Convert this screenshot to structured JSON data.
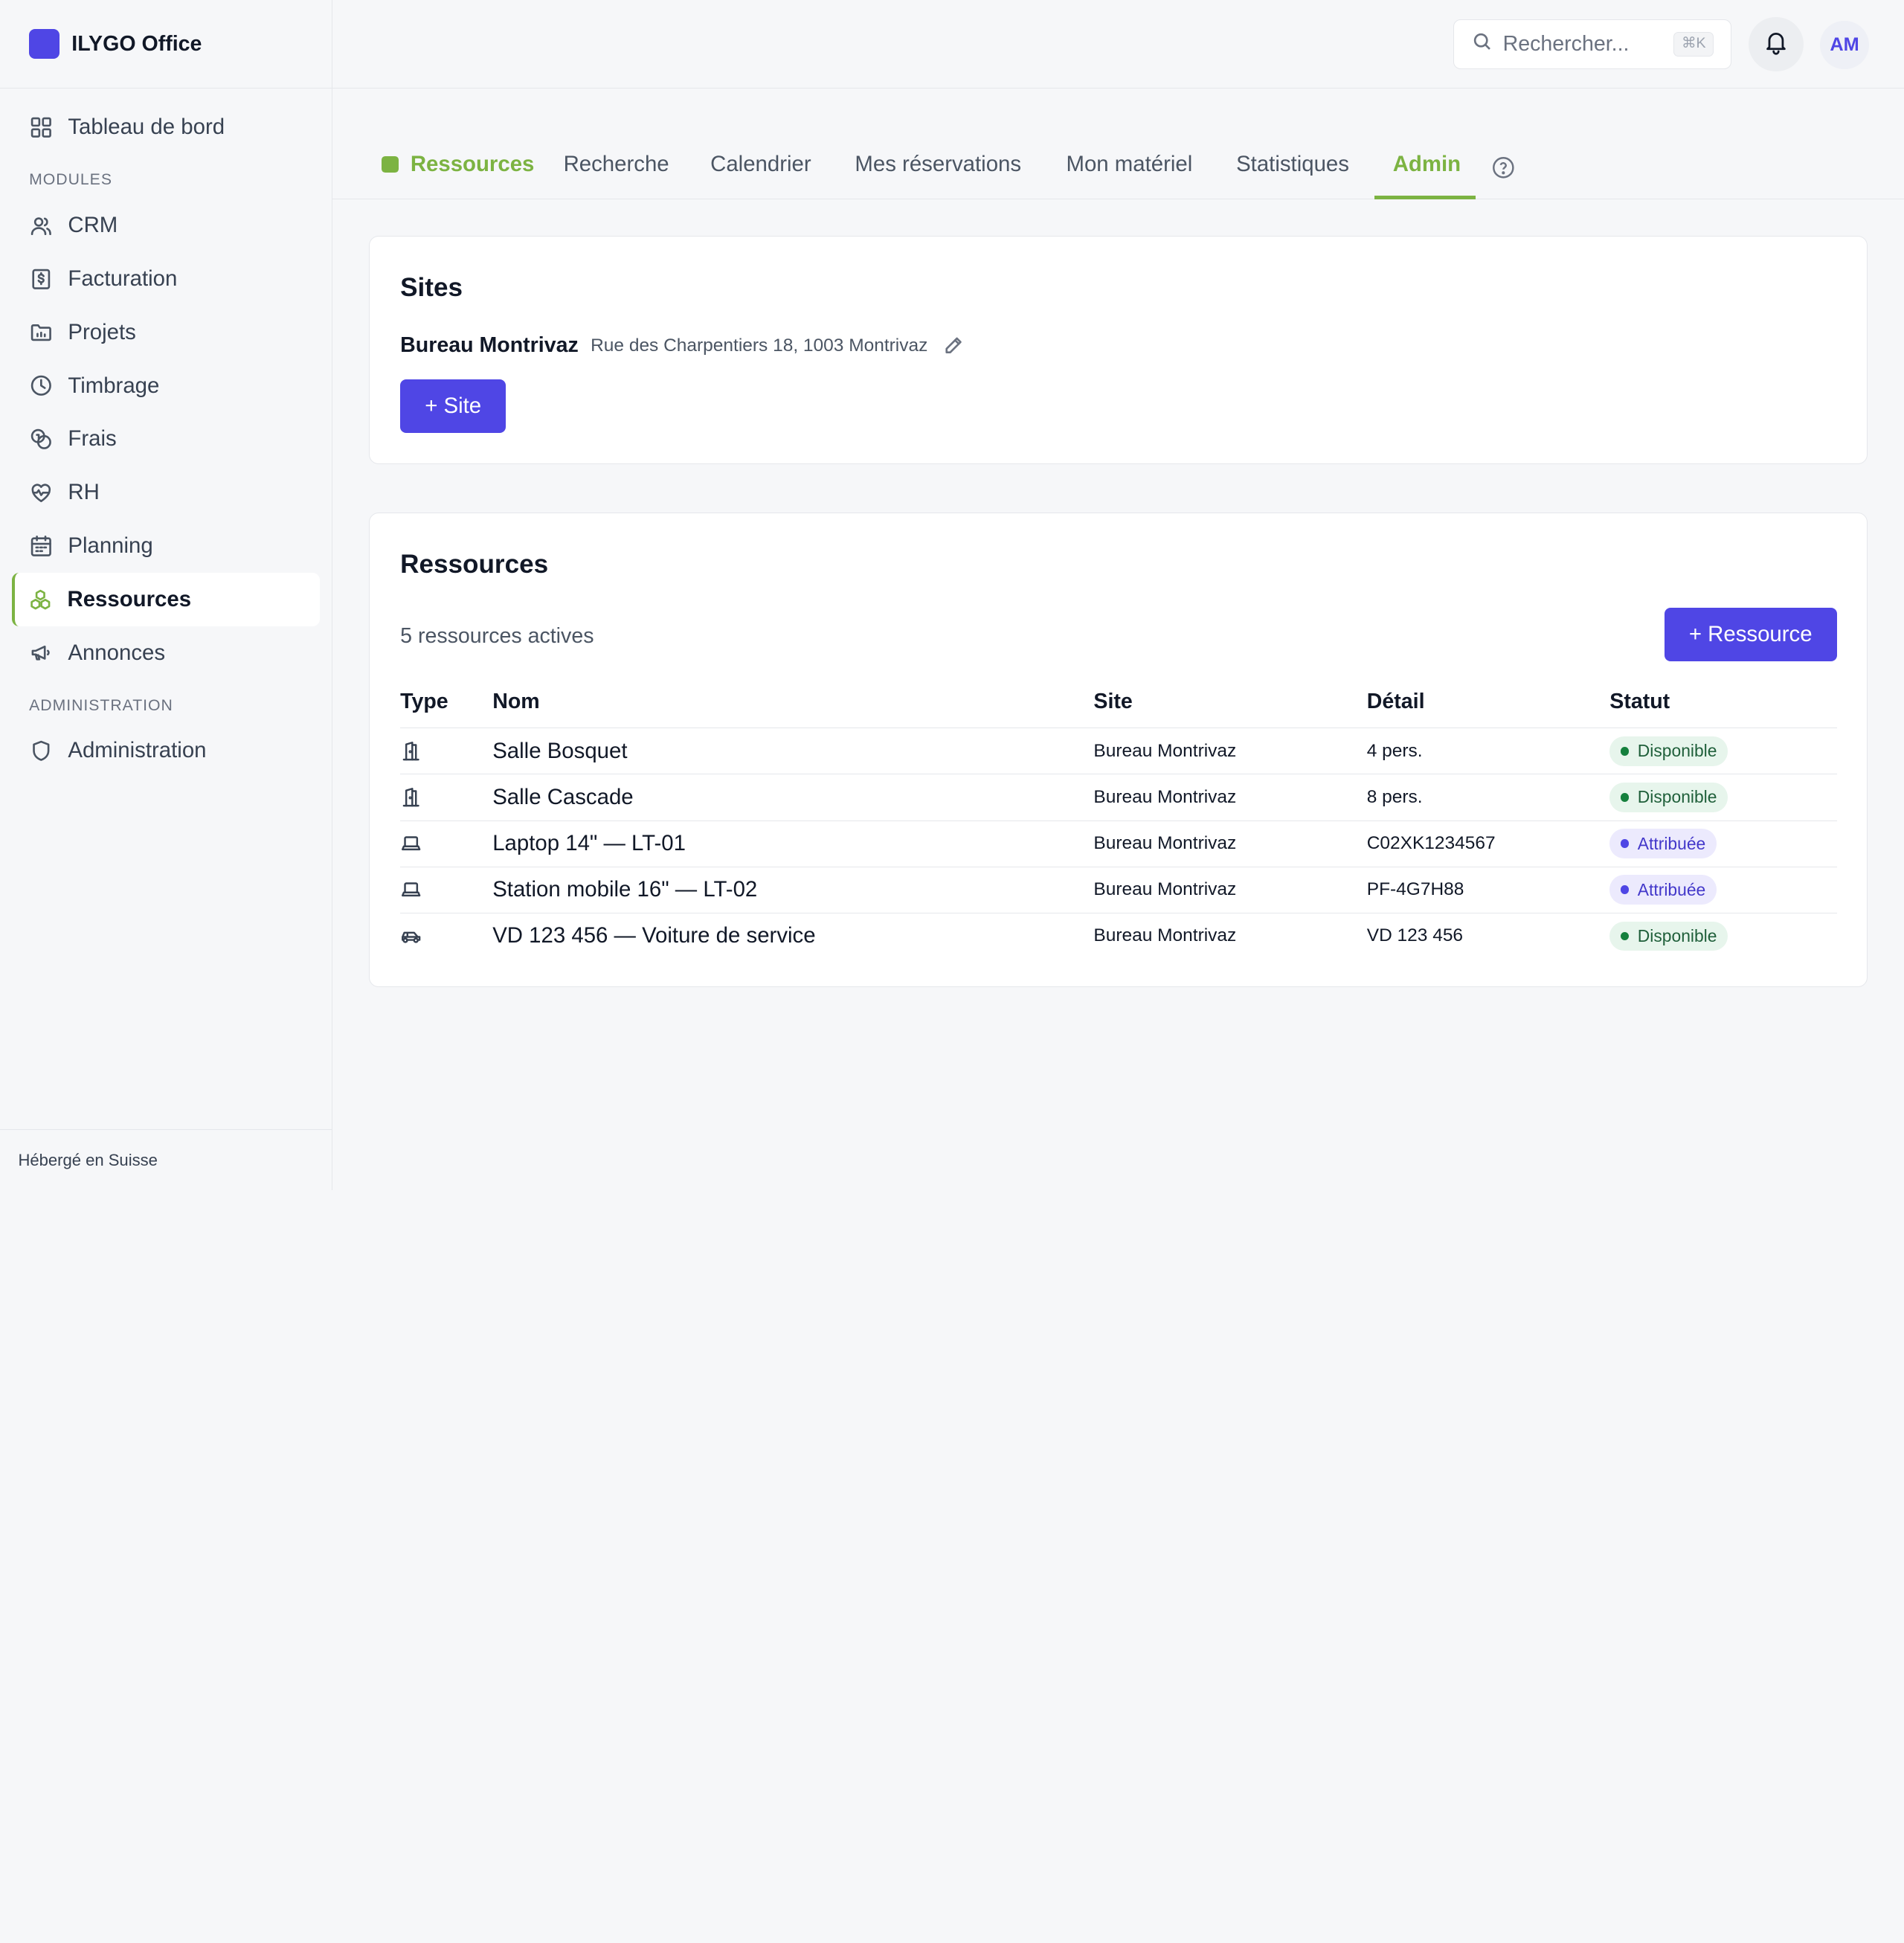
{
  "brand": {
    "name": "ILYGO Office",
    "accent": "#4f46e5"
  },
  "sidebar": {
    "top_item": {
      "label": "Tableau de bord",
      "icon": "grid-icon"
    },
    "section_modules": "MODULES",
    "items": [
      {
        "label": "CRM",
        "icon": "users-icon"
      },
      {
        "label": "Facturation",
        "icon": "invoice-icon"
      },
      {
        "label": "Projets",
        "icon": "folder-icon"
      },
      {
        "label": "Timbrage",
        "icon": "clock-icon"
      },
      {
        "label": "Frais",
        "icon": "coins-icon"
      },
      {
        "label": "RH",
        "icon": "heart-pulse-icon"
      },
      {
        "label": "Planning",
        "icon": "calendar-icon"
      },
      {
        "label": "Ressources",
        "icon": "boxes-icon",
        "active": true
      },
      {
        "label": "Annonces",
        "icon": "megaphone-icon"
      }
    ],
    "section_admin": "ADMINISTRATION",
    "admin_item": {
      "label": "Administration",
      "icon": "shield-icon"
    },
    "footer": "Hébergé en Suisse"
  },
  "header": {
    "search_placeholder": "Rechercher...",
    "search_shortcut": "⌘K",
    "avatar_initials": "AM"
  },
  "tabs": {
    "home": "Ressources",
    "items": [
      "Recherche",
      "Calendrier",
      "Mes réservations",
      "Mon matériel",
      "Statistiques",
      "Admin"
    ],
    "active": "Admin",
    "active_color": "#7cb342"
  },
  "sites": {
    "title": "Sites",
    "entries": [
      {
        "name": "Bureau Montrivaz",
        "address": "Rue des Charpentiers 18, 1003 Montrivaz"
      }
    ],
    "add_label": "+ Site"
  },
  "resources": {
    "title": "Ressources",
    "count_label": "5 ressources actives",
    "add_label": "+ Ressource",
    "columns": [
      "Type",
      "Nom",
      "Site",
      "Détail",
      "Statut"
    ],
    "rows": [
      {
        "type_icon": "room-icon",
        "name": "Salle Bosquet",
        "site": "Bureau Montrivaz",
        "detail": "4 pers.",
        "status": "Disponible",
        "status_kind": "ok"
      },
      {
        "type_icon": "room-icon",
        "name": "Salle Cascade",
        "site": "Bureau Montrivaz",
        "detail": "8 pers.",
        "status": "Disponible",
        "status_kind": "ok"
      },
      {
        "type_icon": "laptop-icon",
        "name": "Laptop 14\" — LT-01",
        "site": "Bureau Montrivaz",
        "detail": "C02XK1234567",
        "status": "Attribuée",
        "status_kind": "att"
      },
      {
        "type_icon": "laptop-icon",
        "name": "Station mobile 16\" — LT-02",
        "site": "Bureau Montrivaz",
        "detail": "PF-4G7H88",
        "status": "Attribuée",
        "status_kind": "att"
      },
      {
        "type_icon": "car-icon",
        "name": "VD 123 456 — Voiture de service",
        "site": "Bureau Montrivaz",
        "detail": "VD 123 456",
        "status": "Disponible",
        "status_kind": "ok"
      }
    ]
  }
}
